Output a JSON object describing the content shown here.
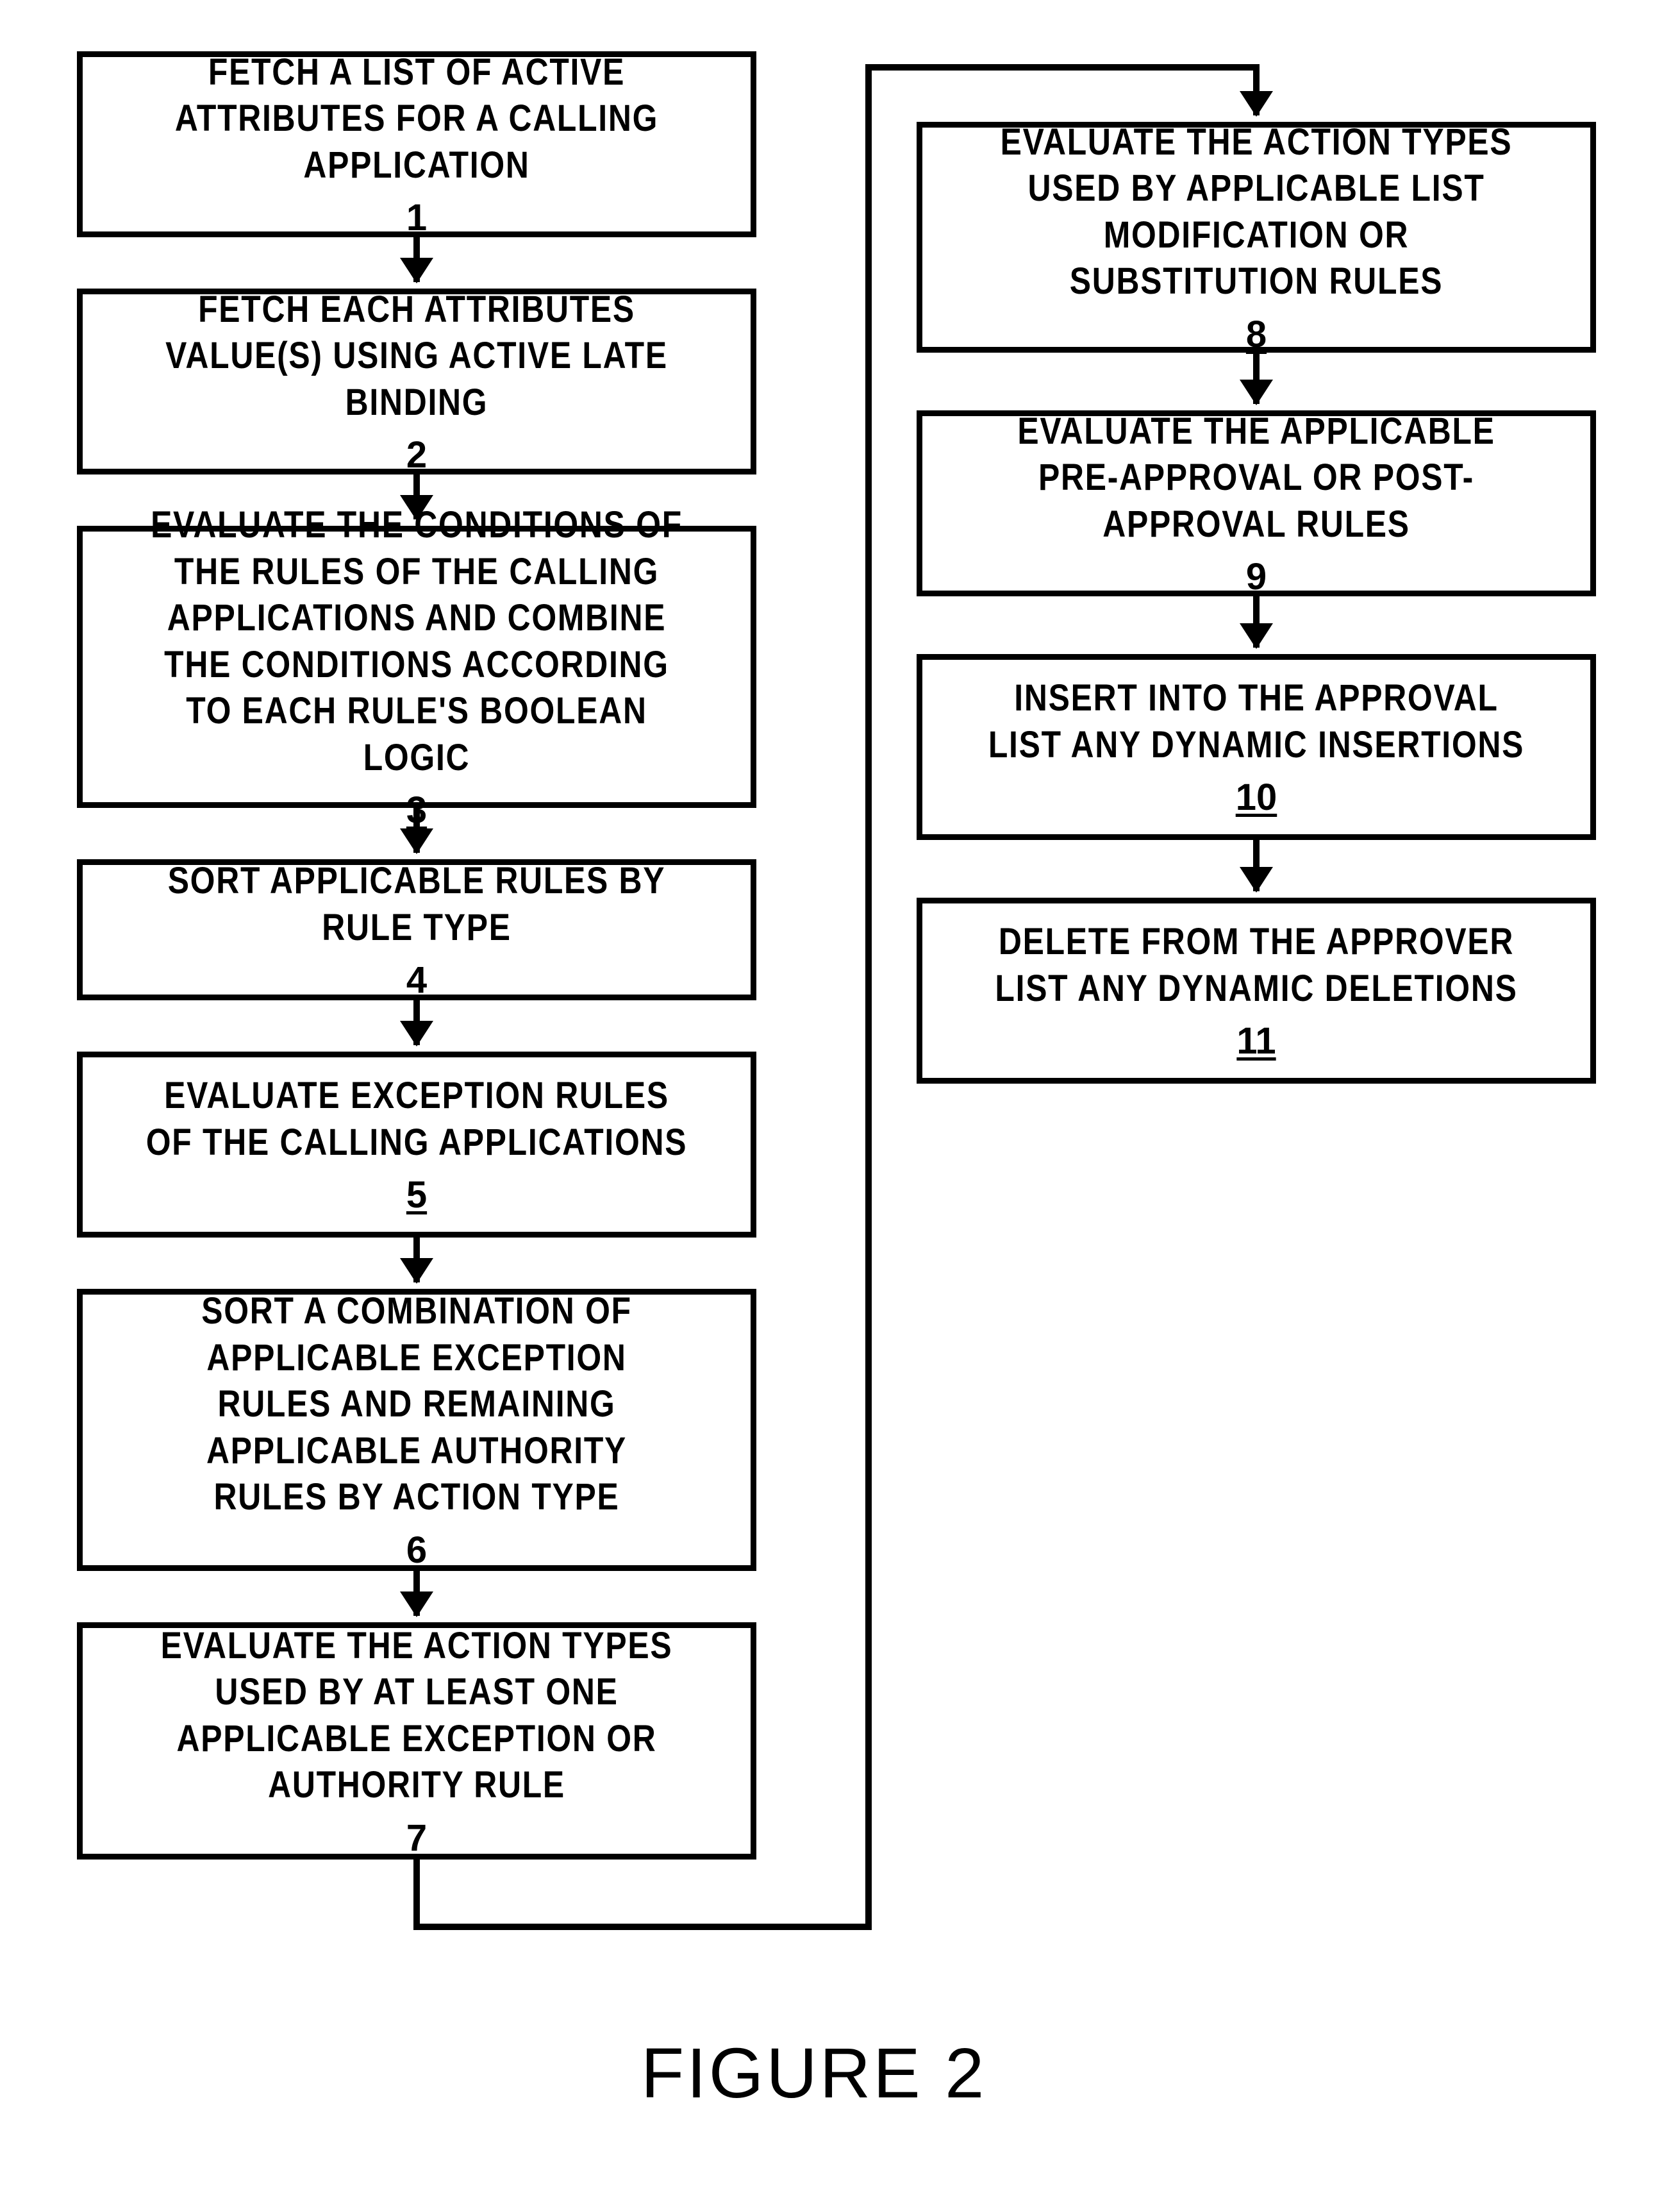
{
  "figure_label": "FIGURE 2",
  "steps": {
    "s1": {
      "text": "FETCH A LIST OF ACTIVE ATTRIBUTES FOR A CALLING APPLICATION",
      "num": "1"
    },
    "s2": {
      "text": "FETCH EACH ATTRIBUTES VALUE(S) USING ACTIVE LATE BINDING",
      "num": "2"
    },
    "s3": {
      "text": "EVALUATE THE CONDITIONS OF THE RULES OF THE CALLING APPLICATIONS AND COMBINE THE CONDITIONS ACCORDING TO EACH RULE'S BOOLEAN LOGIC",
      "num": "3"
    },
    "s4": {
      "text": "SORT APPLICABLE RULES BY RULE TYPE",
      "num": "4"
    },
    "s5": {
      "text": "EVALUATE EXCEPTION RULES OF THE CALLING APPLICATIONS",
      "num": "5"
    },
    "s6": {
      "text": "SORT A COMBINATION OF APPLICABLE EXCEPTION RULES AND REMAINING APPLICABLE AUTHORITY RULES BY ACTION TYPE",
      "num": "6"
    },
    "s7": {
      "text": "EVALUATE THE ACTION TYPES USED BY AT LEAST ONE APPLICABLE EXCEPTION OR AUTHORITY RULE",
      "num": "7"
    },
    "s8": {
      "text": "EVALUATE THE ACTION TYPES USED BY APPLICABLE LIST MODIFICATION OR SUBSTITUTION RULES",
      "num": "8"
    },
    "s9": {
      "text": "EVALUATE THE APPLICABLE PRE-APPROVAL OR POST-APPROVAL RULES",
      "num": "9"
    },
    "s10": {
      "text": "INSERT INTO THE APPROVAL LIST ANY DYNAMIC INSERTIONS",
      "num": "10"
    },
    "s11": {
      "text": "DELETE FROM THE APPROVER LIST ANY DYNAMIC DELETIONS",
      "num": "11"
    }
  }
}
